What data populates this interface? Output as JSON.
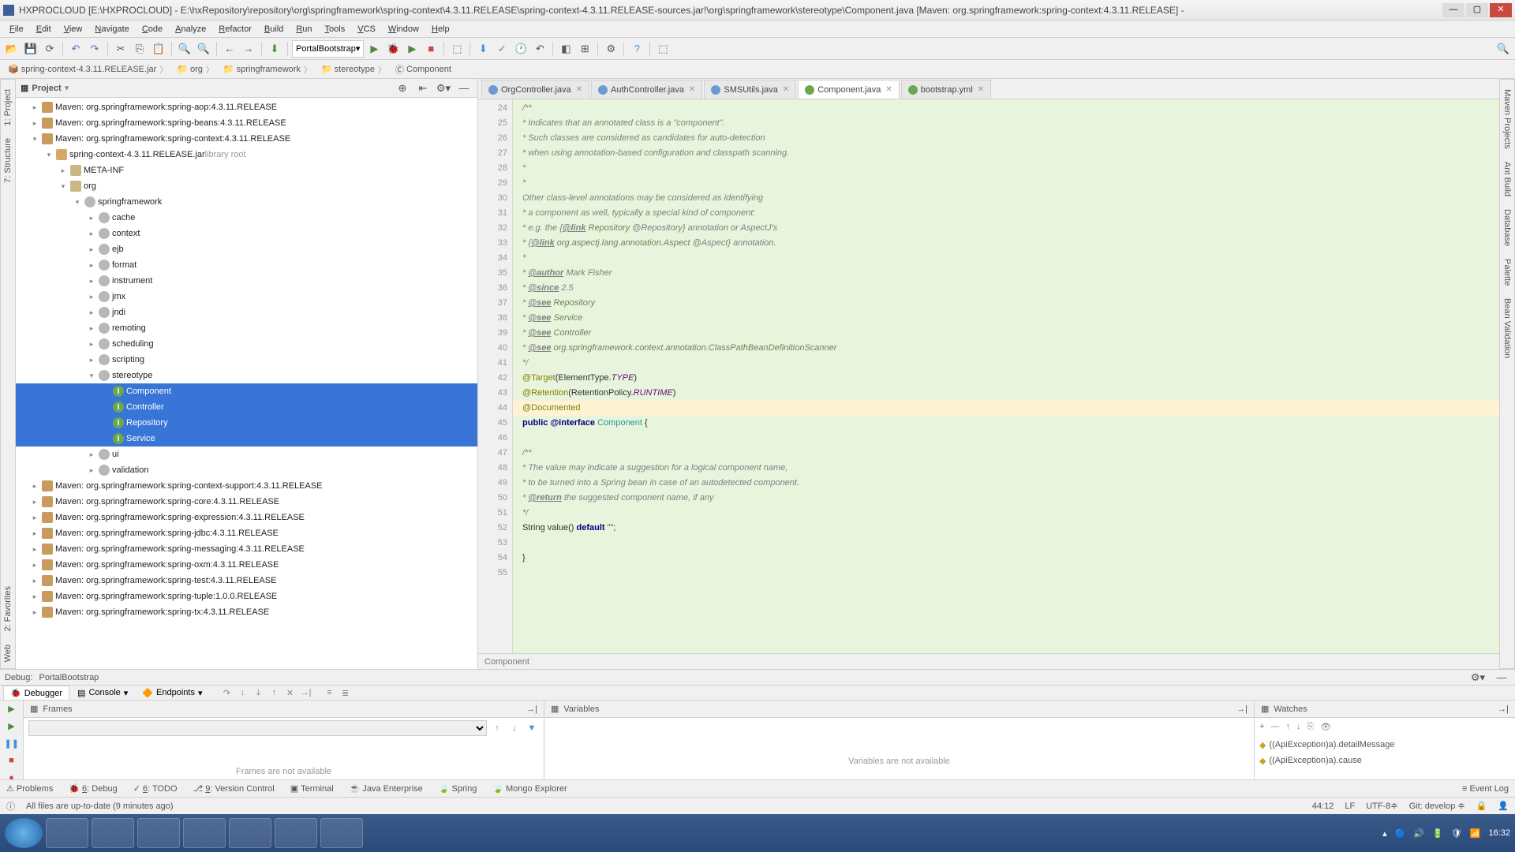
{
  "window": {
    "title": "HXPROCLOUD [E:\\HXPROCLOUD] - E:\\hxRepository\\repository\\org\\springframework\\spring-context\\4.3.11.RELEASE\\spring-context-4.3.11.RELEASE-sources.jar!\\org\\springframework\\stereotype\\Component.java [Maven: org.springframework:spring-context:4.3.11.RELEASE] -"
  },
  "menu": {
    "items": [
      "File",
      "Edit",
      "View",
      "Navigate",
      "Code",
      "Analyze",
      "Refactor",
      "Build",
      "Run",
      "Tools",
      "VCS",
      "Window",
      "Help"
    ]
  },
  "toolbar": {
    "runConfig": "PortalBootstrap"
  },
  "breadcrumb": {
    "items": [
      "spring-context-4.3.11.RELEASE.jar",
      "org",
      "springframework",
      "stereotype",
      "Component"
    ]
  },
  "project": {
    "title": "Project"
  },
  "tree": [
    {
      "d": 1,
      "a": ">",
      "i": "lib",
      "t": "Maven: org.springframework:spring-aop:4.3.11.RELEASE"
    },
    {
      "d": 1,
      "a": ">",
      "i": "lib",
      "t": "Maven: org.springframework:spring-beans:4.3.11.RELEASE"
    },
    {
      "d": 1,
      "a": "v",
      "i": "lib",
      "t": "Maven: org.springframework:spring-context:4.3.11.RELEASE"
    },
    {
      "d": 2,
      "a": "v",
      "i": "jar",
      "t": "spring-context-4.3.11.RELEASE.jar",
      "suf": " library root"
    },
    {
      "d": 3,
      "a": ">",
      "i": "fld",
      "t": "META-INF"
    },
    {
      "d": 3,
      "a": "v",
      "i": "fld",
      "t": "org"
    },
    {
      "d": 4,
      "a": "v",
      "i": "pkg",
      "t": "springframework"
    },
    {
      "d": 5,
      "a": ">",
      "i": "pkg",
      "t": "cache"
    },
    {
      "d": 5,
      "a": ">",
      "i": "pkg",
      "t": "context"
    },
    {
      "d": 5,
      "a": ">",
      "i": "pkg",
      "t": "ejb"
    },
    {
      "d": 5,
      "a": ">",
      "i": "pkg",
      "t": "format"
    },
    {
      "d": 5,
      "a": ">",
      "i": "pkg",
      "t": "instrument"
    },
    {
      "d": 5,
      "a": ">",
      "i": "pkg",
      "t": "jmx"
    },
    {
      "d": 5,
      "a": ">",
      "i": "pkg",
      "t": "jndi"
    },
    {
      "d": 5,
      "a": ">",
      "i": "pkg",
      "t": "remoting"
    },
    {
      "d": 5,
      "a": ">",
      "i": "pkg",
      "t": "scheduling"
    },
    {
      "d": 5,
      "a": ">",
      "i": "pkg",
      "t": "scripting"
    },
    {
      "d": 5,
      "a": "v",
      "i": "pkg",
      "t": "stereotype"
    },
    {
      "d": 6,
      "a": "",
      "i": "class",
      "t": "Component",
      "sel": true
    },
    {
      "d": 6,
      "a": "",
      "i": "class",
      "t": "Controller",
      "sel": true
    },
    {
      "d": 6,
      "a": "",
      "i": "class",
      "t": "Repository",
      "sel": true
    },
    {
      "d": 6,
      "a": "",
      "i": "class",
      "t": "Service",
      "sel": true
    },
    {
      "d": 5,
      "a": ">",
      "i": "pkg",
      "t": "ui"
    },
    {
      "d": 5,
      "a": ">",
      "i": "pkg",
      "t": "validation"
    },
    {
      "d": 1,
      "a": ">",
      "i": "lib",
      "t": "Maven: org.springframework:spring-context-support:4.3.11.RELEASE"
    },
    {
      "d": 1,
      "a": ">",
      "i": "lib",
      "t": "Maven: org.springframework:spring-core:4.3.11.RELEASE"
    },
    {
      "d": 1,
      "a": ">",
      "i": "lib",
      "t": "Maven: org.springframework:spring-expression:4.3.11.RELEASE"
    },
    {
      "d": 1,
      "a": ">",
      "i": "lib",
      "t": "Maven: org.springframework:spring-jdbc:4.3.11.RELEASE"
    },
    {
      "d": 1,
      "a": ">",
      "i": "lib",
      "t": "Maven: org.springframework:spring-messaging:4.3.11.RELEASE"
    },
    {
      "d": 1,
      "a": ">",
      "i": "lib",
      "t": "Maven: org.springframework:spring-oxm:4.3.11.RELEASE"
    },
    {
      "d": 1,
      "a": ">",
      "i": "lib",
      "t": "Maven: org.springframework:spring-test:4.3.11.RELEASE"
    },
    {
      "d": 1,
      "a": ">",
      "i": "lib",
      "t": "Maven: org.springframework:spring-tuple:1.0.0.RELEASE"
    },
    {
      "d": 1,
      "a": ">",
      "i": "lib",
      "t": "Maven: org.springframework:spring-tx:4.3.11.RELEASE"
    }
  ],
  "tabs": [
    {
      "label": "OrgController.java",
      "color": "#6c9bd1"
    },
    {
      "label": "AuthController.java",
      "color": "#6c9bd1"
    },
    {
      "label": "SMSUtils.java",
      "color": "#6c9bd1"
    },
    {
      "label": "Component.java",
      "color": "#6aa84f",
      "active": true
    },
    {
      "label": "bootstrap.yml",
      "color": "#6aa84f"
    }
  ],
  "gutter": {
    "start": 24,
    "end": 55
  },
  "code": [
    {
      "cm": "/**"
    },
    {
      "cm": " * Indicates that an annotated class is a \"component\"."
    },
    {
      "cm": " * Such classes are considered as candidates for auto-detection"
    },
    {
      "cm": " * when using annotation-based configuration and classpath scanning."
    },
    {
      "cm": " *"
    },
    {
      "cm": " * <p>Other class-level annotations may be considered as identifying"
    },
    {
      "cm": " * a component as well, typically a special kind of component:"
    },
    {
      "raw": " * e.g. the {<span class='c-tag'>@link</span> <span class='c-cl'>Repository</span> @Repository} annotation or AspectJ's",
      "cm": true
    },
    {
      "raw": " * {<span class='c-tag'>@link</span> <span class='c-cl'>org.aspectj.lang.annotation.Aspect</span> @Aspect} annotation.",
      "cm": true
    },
    {
      "cm": " *"
    },
    {
      "raw": " * <span class='c-tag'>@author</span> Mark Fisher",
      "cm": true
    },
    {
      "raw": " * <span class='c-tag'>@since</span> 2.5",
      "cm": true
    },
    {
      "raw": " * <span class='c-tag'>@see</span> <span class='c-cl'>Repository</span>",
      "cm": true
    },
    {
      "raw": " * <span class='c-tag'>@see</span> <span class='c-cl'>Service</span>",
      "cm": true
    },
    {
      "raw": " * <span class='c-tag'>@see</span> <span class='c-cl'>Controller</span>",
      "cm": true
    },
    {
      "raw": " * <span class='c-tag'>@see</span> <span class='c-cl'>org.springframework.context.annotation.ClassPathBeanDefinitionScanner</span>",
      "cm": true
    },
    {
      "cm": " */"
    },
    {
      "raw": "<span class='c-an'>@Target</span>(ElementType.<span class='c-cl' style='font-style:italic;color:#660e7a'>TYPE</span>)"
    },
    {
      "raw": "<span class='c-an'>@Retention</span>(RetentionPolicy.<span class='c-cl' style='font-style:italic;color:#660e7a'>RUNTIME</span>)"
    },
    {
      "raw": "<span class='c-an'>@Documented</span>",
      "hl": true
    },
    {
      "raw": "<span class='c-kw'>public</span> <span class='c-kw'>@interface</span> <span style='color:#20999d'>Component</span> {"
    },
    {
      "raw": ""
    },
    {
      "cm": "    /**"
    },
    {
      "cm": "     * The value may indicate a suggestion for a logical component name,"
    },
    {
      "cm": "     * to be turned into a Spring bean in case of an autodetected component."
    },
    {
      "raw": "     * <span class='c-tag'>@return</span> the suggested component name, if any",
      "cm": true
    },
    {
      "cm": "     */"
    },
    {
      "raw": "    String value() <span class='c-kw'>default</span> <span style='color:#008000'>\"\"</span>;"
    },
    {
      "raw": ""
    },
    {
      "raw": "}"
    },
    {
      "raw": ""
    }
  ],
  "editorBreadcrumb": "Component",
  "debug": {
    "label": "Debug:",
    "target": "PortalBootstrap",
    "tabs": {
      "debugger": "Debugger",
      "console": "Console",
      "endpoints": "Endpoints"
    },
    "frames": {
      "title": "Frames",
      "empty": "Frames are not available"
    },
    "vars": {
      "title": "Variables",
      "empty": "Variables are not available"
    },
    "watches": {
      "title": "Watches",
      "items": [
        "((ApiException)a).detailMessage",
        "((ApiException)a).cause"
      ]
    }
  },
  "bottomTabs": [
    "Problems",
    "6: Debug",
    "6: TODO",
    "9: Version Control",
    "Terminal",
    "Java Enterprise",
    "Spring",
    "Mongo Explorer"
  ],
  "eventLog": "Event Log",
  "status": {
    "msg": "All files are up-to-date (9 minutes ago)",
    "pos": "44:12",
    "le": "LF",
    "enc": "UTF-8",
    "git": "Git: develop"
  },
  "clock": "16:32",
  "rightTabs": [
    "Maven Projects",
    "Ant Build",
    "Database",
    "Palette",
    "Bean Validation"
  ],
  "leftTabs": [
    "1: Project",
    "7: Structure"
  ],
  "leftTabs2": [
    "2: Favorites",
    "Web"
  ]
}
